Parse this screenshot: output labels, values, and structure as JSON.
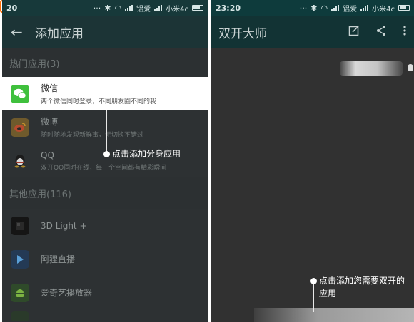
{
  "left": {
    "status": {
      "time": "20",
      "carrier": "铝爱",
      "carrier2": "小米4c"
    },
    "toolbar": {
      "title": "添加应用"
    },
    "hot_section": "热门应用(3)",
    "hot_apps": [
      {
        "name": "微信",
        "desc": "两个微信同时登录，不同朋友圈不同的我"
      },
      {
        "name": "微博",
        "desc": "随时随地发现新鲜事，无切换不错过"
      },
      {
        "name": "QQ",
        "desc": "双开QQ同时在线，每一个空间都有精彩瞬间"
      }
    ],
    "other_section": "其他应用(116)",
    "other_apps": [
      {
        "name": "3D Light +"
      },
      {
        "name": "阿狸直播"
      },
      {
        "name": "爱奇艺播放器"
      }
    ],
    "callout": "点击添加分身应用"
  },
  "right": {
    "status": {
      "time": "23:20",
      "carrier": "铝爱",
      "carrier2": "小米4c"
    },
    "toolbar": {
      "title": "双开大师"
    },
    "callout_line1": "点击添加您需要双开的",
    "callout_line2": "应用"
  }
}
